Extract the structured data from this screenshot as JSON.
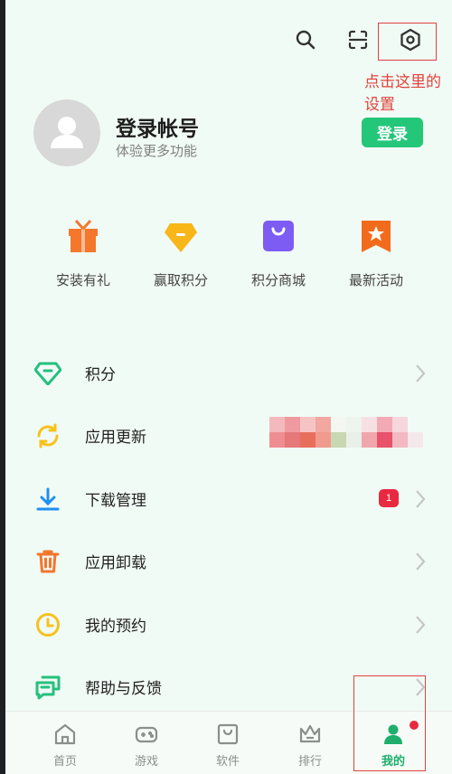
{
  "top_icons": {
    "search": "search-icon",
    "scan": "scan-icon",
    "settings": "settings-icon"
  },
  "annotation": {
    "line1": "点击这里的",
    "line2": "设置"
  },
  "profile": {
    "title": "登录帐号",
    "subtitle": "体验更多功能",
    "login_label": "登录"
  },
  "quick_actions": [
    {
      "label": "安装有礼",
      "icon": "gift-icon",
      "color": "#f4772c"
    },
    {
      "label": "赢取积分",
      "icon": "diamond-icon",
      "color": "#f8b619"
    },
    {
      "label": "积分商城",
      "icon": "shopping-bag-icon",
      "color": "#7c5cf2"
    },
    {
      "label": "最新活动",
      "icon": "star-flag-icon",
      "color": "#f26b1d"
    }
  ],
  "menu": [
    {
      "label": "积分",
      "icon": "diamond-outline-icon"
    },
    {
      "label": "应用更新",
      "icon": "refresh-icon"
    },
    {
      "label": "下载管理",
      "icon": "download-icon",
      "badge": "1"
    },
    {
      "label": "应用卸载",
      "icon": "trash-icon"
    },
    {
      "label": "我的预约",
      "icon": "clock-icon"
    },
    {
      "label": "帮助与反馈",
      "icon": "feedback-icon"
    }
  ],
  "tabs": [
    {
      "label": "首页",
      "icon": "home-icon"
    },
    {
      "label": "游戏",
      "icon": "gamepad-icon"
    },
    {
      "label": "软件",
      "icon": "bag-icon"
    },
    {
      "label": "排行",
      "icon": "crown-icon"
    },
    {
      "label": "我的",
      "icon": "user-icon",
      "active": true
    }
  ],
  "colors": {
    "accent": "#24c77a",
    "annotation": "#e0433c",
    "badge": "#e8293f"
  }
}
